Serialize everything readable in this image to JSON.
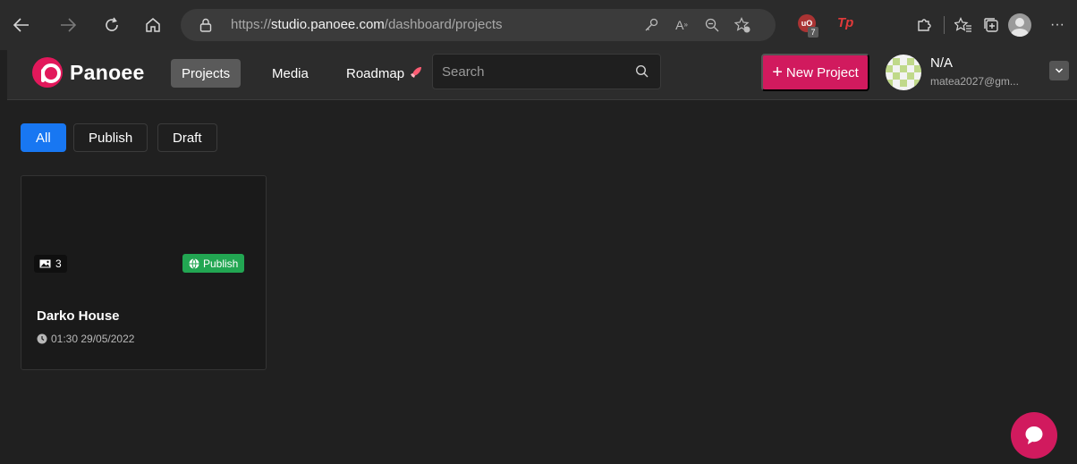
{
  "browser": {
    "url_prefix": "https://",
    "url_domain": "studio.panoee.com",
    "url_path": "/dashboard/projects",
    "extension_count": "7",
    "extension_tp": "Tp",
    "icons": [
      "back-icon",
      "forward-icon",
      "refresh-icon",
      "home-icon",
      "lock-icon",
      "key-icon",
      "read-aloud-icon",
      "zoom-icon",
      "add-favorite-icon",
      "extensions-icon",
      "favorites-icon",
      "collections-icon",
      "profile-icon",
      "more-icon"
    ]
  },
  "header": {
    "logo_text": "Panoee",
    "nav": [
      {
        "label": "Projects",
        "active": true
      },
      {
        "label": "Media",
        "active": false
      },
      {
        "label": "Roadmap",
        "active": false
      }
    ],
    "search_placeholder": "Search",
    "new_project_label": "New Project",
    "user_name": "N/A",
    "user_email": "matea2027@gm..."
  },
  "filters": [
    {
      "label": "All",
      "active": true
    },
    {
      "label": "Publish",
      "active": false
    },
    {
      "label": "Draft",
      "active": false
    }
  ],
  "projects": [
    {
      "title": "Darko House",
      "image_count": "3",
      "status": "Publish",
      "timestamp": "01:30 29/05/2022"
    }
  ],
  "colors": {
    "brand": "#d11a5e",
    "active_filter": "#1877f2",
    "publish_badge": "#22a652"
  }
}
